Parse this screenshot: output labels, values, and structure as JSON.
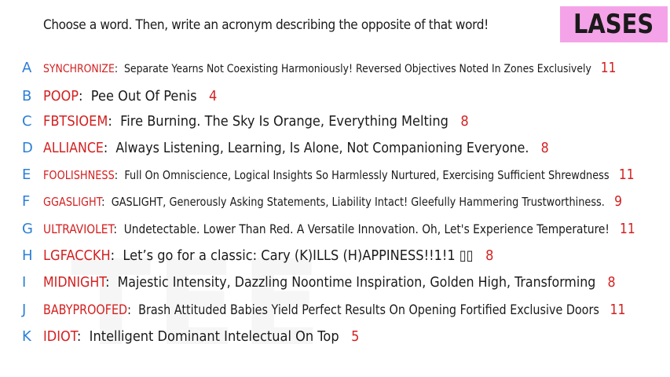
{
  "header": {
    "prompt": "Choose a word. Then, write an acronym describing the opposite of that word!",
    "player_name": "LASES"
  },
  "watermark_text": "TEE",
  "entries": [
    {
      "letter": "A",
      "word": "SYNCHRONIZE",
      "acronym": "Separate Yearns Not Coexisting Harmoniously! Reversed Objectives Noted In Zones Exclusively",
      "score": "11"
    },
    {
      "letter": "B",
      "word": "POOP",
      "acronym": "Pee Out Of Penis",
      "score": "4"
    },
    {
      "letter": "C",
      "word": "FBTSIOEM",
      "acronym": "Fire Burning. The Sky Is Orange, Everything Melting",
      "score": "8"
    },
    {
      "letter": "D",
      "word": "ALLIANCE",
      "acronym": "Always Listening, Learning, Is Alone, Not Companioning Everyone.",
      "score": "8"
    },
    {
      "letter": "E",
      "word": "FOOLISHNESS",
      "acronym": "Full On Omniscience, Logical Insights So Harmlessly Nurtured, Exercising Sufficient Shrewdness",
      "score": "11"
    },
    {
      "letter": "F",
      "word": "GGASLIGHT",
      "acronym": "GASLIGHT, Generously Asking Statements, Liability Intact! Gleefully Hammering Trustworthiness.",
      "score": "9"
    },
    {
      "letter": "G",
      "word": "ULTRAVIOLET",
      "acronym": "Undetectable. Lower Than Red. A Versatile Innovation. Oh, Let's Experience Temperature!",
      "score": "11"
    },
    {
      "letter": "H",
      "word": "LGFACCKH",
      "acronym": "Let’s go for a classic: Cary (K)ILLS (H)APPINESS!!1!1 ▯▯",
      "score": "8"
    },
    {
      "letter": "I",
      "word": "MIDNIGHT",
      "acronym": "Majestic Intensity, Dazzling Noontime Inspiration, Golden High, Transforming",
      "score": "8"
    },
    {
      "letter": "J",
      "word": "BABYPROOFED",
      "acronym": "Brash Attituded Babies Yield Perfect Results On Opening Fortified Exclusive Doors",
      "score": "11"
    },
    {
      "letter": "K",
      "word": "IDIOT",
      "acronym": "Intelligent Dominant Intelectual On Top",
      "score": "5"
    }
  ]
}
